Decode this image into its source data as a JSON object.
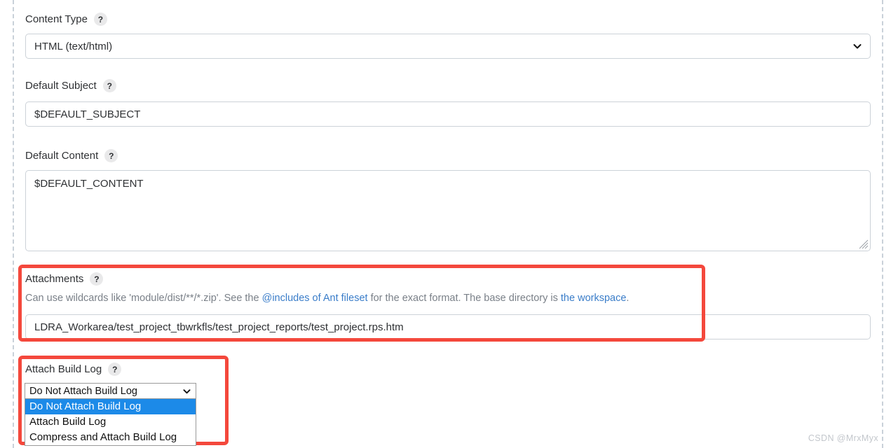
{
  "fields": {
    "content_type": {
      "label": "Content Type",
      "help_icon": "?",
      "value": "HTML (text/html)"
    },
    "default_subject": {
      "label": "Default Subject",
      "help_icon": "?",
      "value": "$DEFAULT_SUBJECT"
    },
    "default_content": {
      "label": "Default Content",
      "help_icon": "?",
      "value": "$DEFAULT_CONTENT"
    },
    "attachments": {
      "label": "Attachments",
      "help_icon": "?",
      "value": "LDRA_Workarea/test_project_tbwrkfls/test_project_reports/test_project.rps.htm",
      "description": {
        "part1": "Can use wildcards like 'module/dist/**/*.zip'. See the ",
        "link1": "@includes of Ant fileset",
        "part2": " for the exact format. The base directory is ",
        "link2": "the workspace",
        "part3": "."
      }
    },
    "attach_build_log": {
      "label": "Attach Build Log",
      "help_icon": "?",
      "selected": "Do Not Attach Build Log",
      "options": [
        "Do Not Attach Build Log",
        "Attach Build Log",
        "Compress and Attach Build Log"
      ]
    }
  },
  "watermark": "CSDN @MrxMyx",
  "colors": {
    "highlight_red": "#f4483c",
    "option_selected_blue": "#1c8ae8",
    "link_blue": "#3a7dc9"
  }
}
